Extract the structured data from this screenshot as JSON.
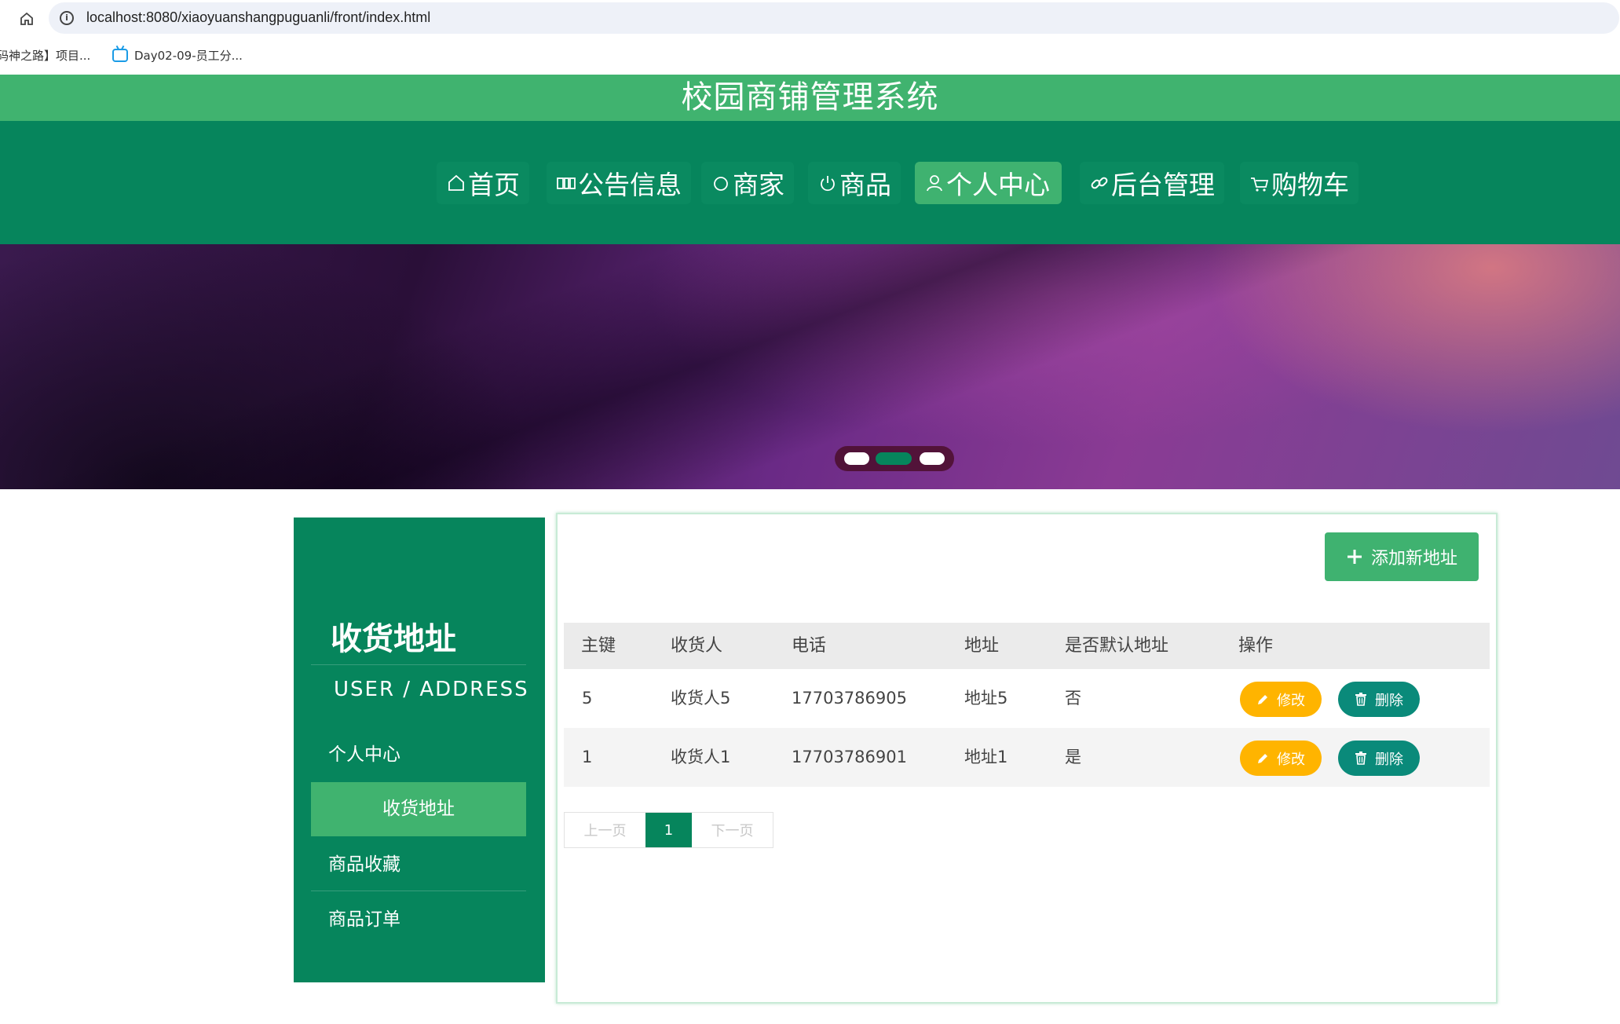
{
  "browser": {
    "url": "localhost:8080/xiaoyuanshangpuguanli/front/index.html",
    "bookmarks": [
      "码神之路】项目...",
      "Day02-09-员工分..."
    ]
  },
  "site_title": "校园商铺管理系统",
  "nav": [
    {
      "label": "首页",
      "icon": "home-icon",
      "active": false
    },
    {
      "label": "公告信息",
      "icon": "notice-icon",
      "active": false
    },
    {
      "label": "商家",
      "icon": "circle-icon",
      "active": false
    },
    {
      "label": "商品",
      "icon": "power-icon",
      "active": false
    },
    {
      "label": "个人中心",
      "icon": "user-icon",
      "active": true
    },
    {
      "label": "后台管理",
      "icon": "link-icon",
      "active": false
    },
    {
      "label": "购物车",
      "icon": "cart-icon",
      "active": false
    }
  ],
  "carousel": {
    "slide_count": 3,
    "active_index": 1
  },
  "sidebar": {
    "title": "收货地址",
    "subtitle": "USER / ADDRESS",
    "items": [
      {
        "label": "个人中心",
        "active": false
      },
      {
        "label": "收货地址",
        "active": true
      },
      {
        "label": "商品收藏",
        "active": false
      },
      {
        "label": "商品订单",
        "active": false
      }
    ]
  },
  "main": {
    "add_button": "添加新地址",
    "columns": [
      "主键",
      "收货人",
      "电话",
      "地址",
      "是否默认地址",
      "操作"
    ],
    "rows": [
      {
        "id": "5",
        "name": "收货人5",
        "phone": "17703786905",
        "address": "地址5",
        "is_default": "否"
      },
      {
        "id": "1",
        "name": "收货人1",
        "phone": "17703786901",
        "address": "地址1",
        "is_default": "是"
      }
    ],
    "edit_label": "修改",
    "delete_label": "删除",
    "pager": {
      "prev": "上一页",
      "current": "1",
      "next": "下一页"
    }
  },
  "colors": {
    "primary": "#06855c",
    "accent": "#40b36f",
    "edit": "#ffb400",
    "delete": "#0a8a7a"
  }
}
